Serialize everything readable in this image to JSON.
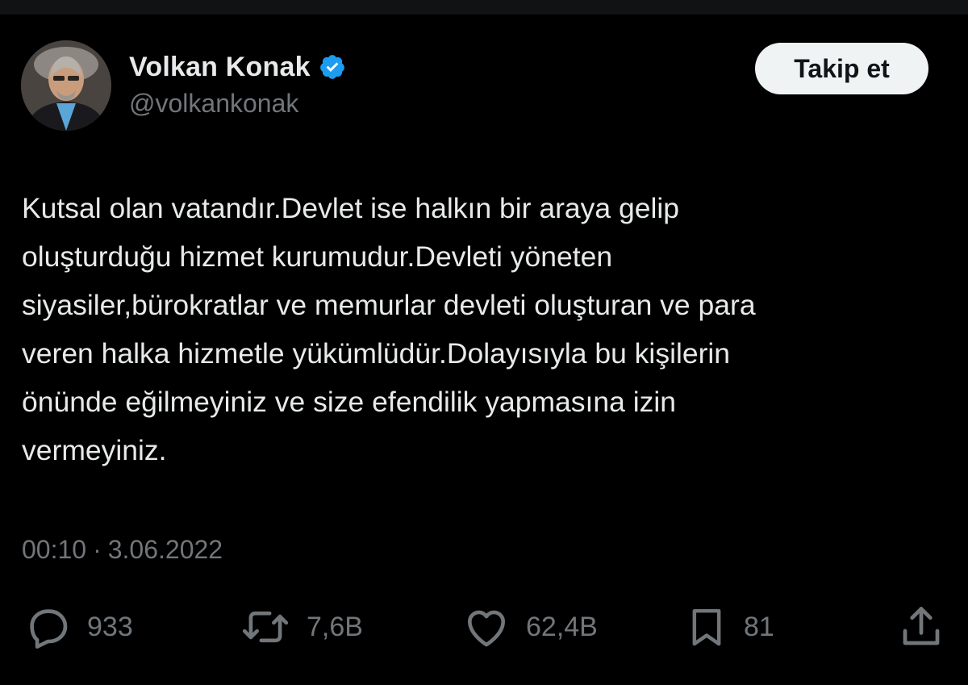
{
  "profile": {
    "display_name": "Volkan Konak",
    "handle": "@volkankonak",
    "avatar_icon": "avatar-photo",
    "verified_icon": "verified-badge-icon",
    "verified_color": "#1d9bf0"
  },
  "follow_button": {
    "label": "Takip et"
  },
  "tweet": {
    "text": "Kutsal olan vatandır.Devlet ise halkın bir araya gelip\noluşturduğu hizmet kurumudur.Devleti yöneten\nsiyasiler,bürokratlar ve memurlar devleti oluşturan ve para\nveren halka hizmetle yükümlüdür.Dolayısıyla bu kişilerin\nönünde eğilmeyiniz ve size efendilik yapmasına izin\nvermeyiniz.",
    "time": "00:10",
    "separator": "·",
    "date": "3.06.2022"
  },
  "actions": {
    "reply": {
      "icon": "reply-icon",
      "count": "933"
    },
    "retweet": {
      "icon": "retweet-icon",
      "count": "7,6B"
    },
    "like": {
      "icon": "heart-icon",
      "count": "62,4B"
    },
    "bookmark": {
      "icon": "bookmark-icon",
      "count": "81"
    },
    "share": {
      "icon": "share-icon"
    }
  },
  "colors": {
    "background": "#000000",
    "primary_text": "#e7e9ea",
    "secondary_text": "#71767b",
    "button_bg": "#eff3f4",
    "button_text": "#0f1419"
  }
}
